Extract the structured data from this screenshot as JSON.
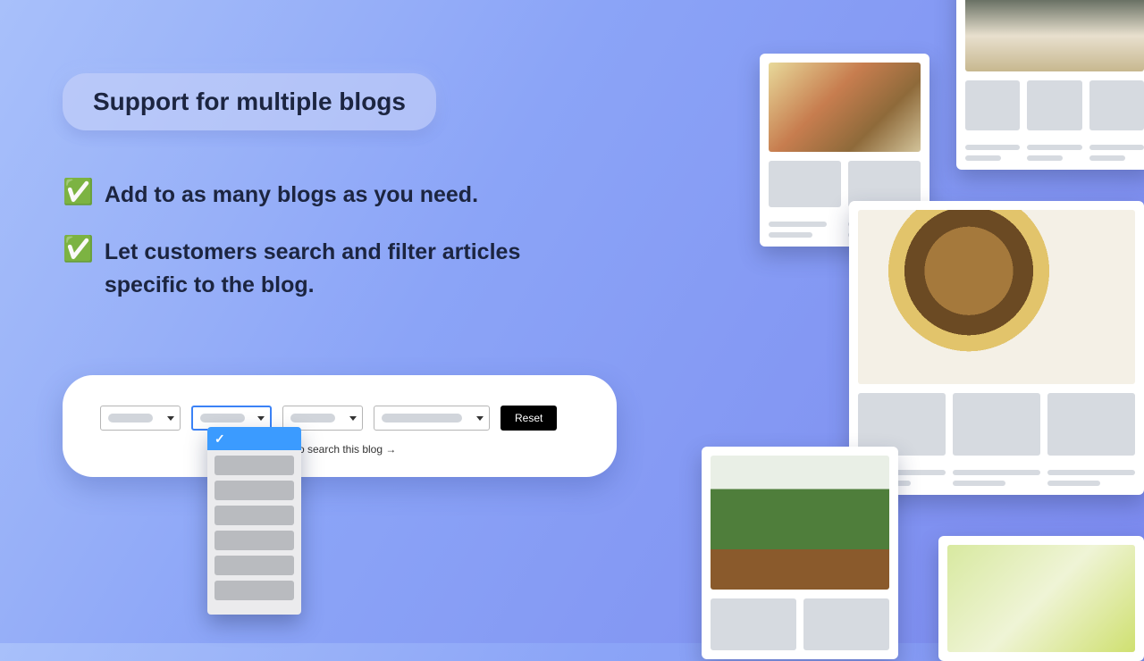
{
  "title": "Support for multiple blogs",
  "bullets": [
    "Add to as many blogs as you need.",
    "Let customers search and filter articles specific to the blog."
  ],
  "filter": {
    "reset": "Reset",
    "search_hint": "re to search this blog →"
  }
}
